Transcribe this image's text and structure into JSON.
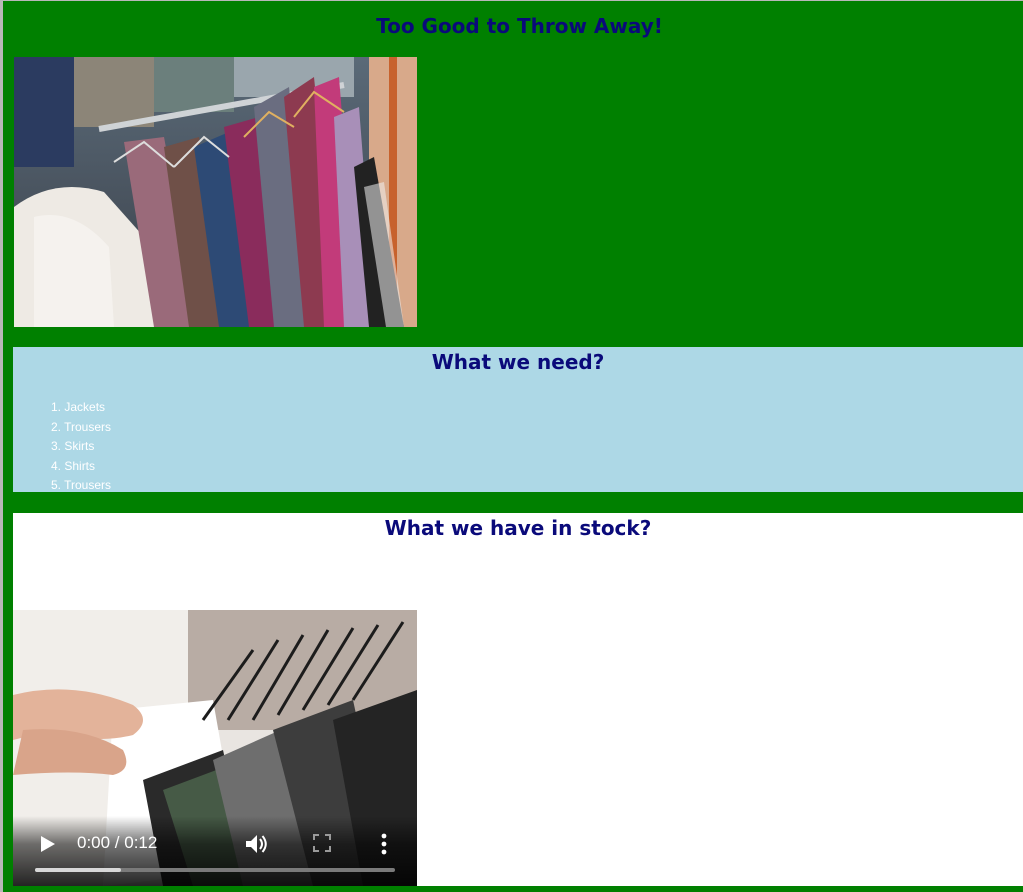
{
  "page": {
    "title": "Too Good to Throw Away!"
  },
  "need": {
    "heading": "What we need?",
    "items": [
      "Jackets",
      "Trousers",
      "Skirts",
      "Shirts",
      "Trousers"
    ]
  },
  "stock": {
    "heading": "What we have in stock?"
  },
  "video": {
    "time": "0:00 / 0:12",
    "progress_fraction": 0.24
  },
  "icons": {
    "play": "play-icon",
    "volume": "volume-icon",
    "fullscreen": "fullscreen-icon",
    "more": "more-vertical-icon"
  },
  "colors": {
    "page_background": "#008000",
    "need_background": "#add8e6",
    "stock_background": "#ffffff",
    "heading": "#0a0a7a",
    "list_text": "#ffffff"
  }
}
